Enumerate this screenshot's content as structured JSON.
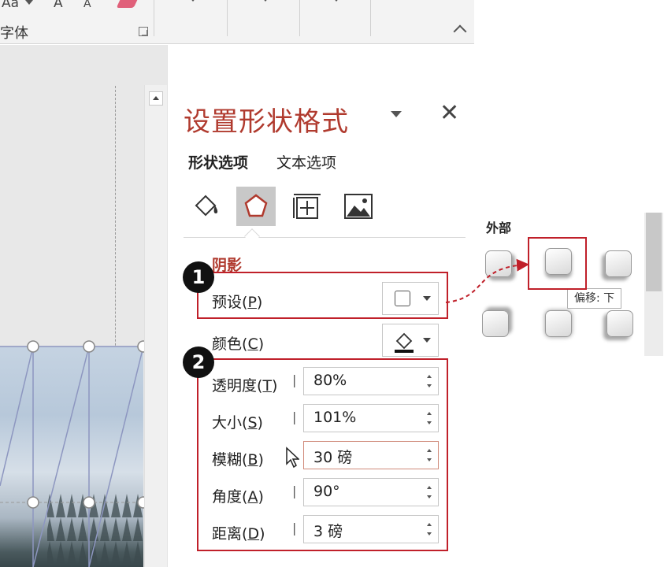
{
  "ribbon": {
    "font_group_label": "字体",
    "font_buttons_partial": [
      "Aa",
      "A",
      "A"
    ]
  },
  "pane": {
    "title": "设置形状格式",
    "tabs": [
      {
        "label": "形状选项",
        "active": true
      },
      {
        "label": "文本选项",
        "active": false
      }
    ],
    "category_icons": [
      "fill-line-icon",
      "effects-pentagon-icon",
      "size-properties-icon",
      "picture-icon"
    ],
    "selected_category": "effects-pentagon-icon",
    "section_title": "阴影",
    "preset": {
      "label": "预设",
      "key": "P"
    },
    "color": {
      "label": "颜色",
      "key": "C"
    },
    "fields": [
      {
        "label": "透明度",
        "key": "T",
        "value": "80%"
      },
      {
        "label": "大小",
        "key": "S",
        "value": "101%"
      },
      {
        "label": "模糊",
        "key": "B",
        "value": "30 磅"
      },
      {
        "label": "角度",
        "key": "A",
        "value": "90°"
      },
      {
        "label": "距离",
        "key": "D",
        "value": "3 磅"
      }
    ]
  },
  "annotations": {
    "badge_1": "1",
    "badge_2": "2",
    "highlight_color": "#c0202a"
  },
  "preset_gallery": {
    "header": "外部",
    "tooltip": "偏移: 下",
    "selected_tile": "offset-bottom"
  },
  "colors": {
    "accent": "#b03a2e",
    "highlight": "#c0202a",
    "selected_icon_bg": "#c8c8c8"
  }
}
